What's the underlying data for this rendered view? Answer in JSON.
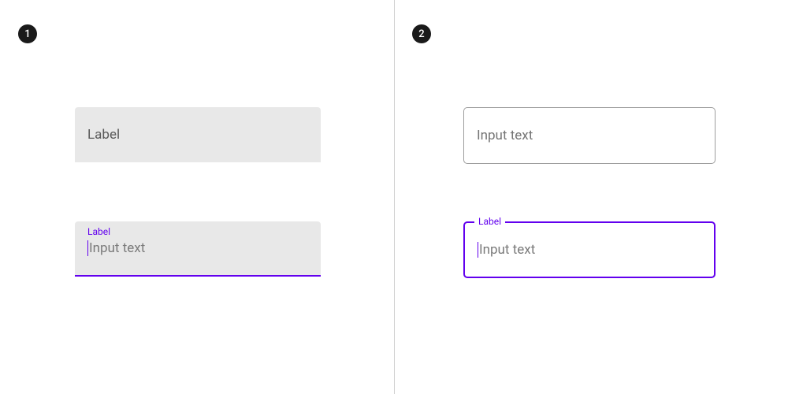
{
  "badges": {
    "left": "1",
    "right": "2"
  },
  "filled": {
    "default": {
      "label": "Label"
    },
    "focused": {
      "label": "Label",
      "input": "Input text"
    }
  },
  "outlined": {
    "default": {
      "placeholder": "Input text"
    },
    "focused": {
      "label": "Label",
      "input": "Input text"
    }
  }
}
